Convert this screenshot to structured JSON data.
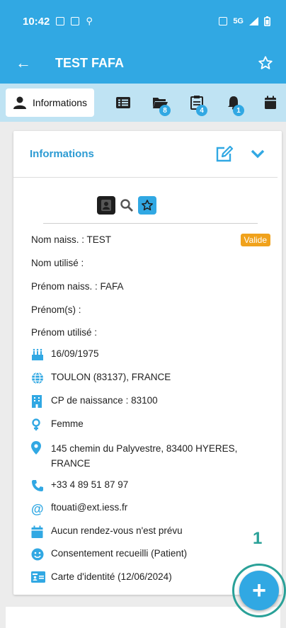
{
  "status_bar": {
    "time": "10:42",
    "network": "5G"
  },
  "app_bar": {
    "title": "TEST FAFA"
  },
  "tabs": {
    "active_label": "Informations",
    "badges": {
      "folder": "8",
      "document": "4",
      "alerts": "1"
    }
  },
  "card": {
    "title": "Informations",
    "status_badge": "Valide",
    "fields": {
      "nom_naiss": "Nom naiss. :  TEST",
      "nom_utilise": "Nom utilisé :",
      "prenom_naiss": "Prénom naiss. :  FAFA",
      "prenoms": "Prénom(s) :",
      "prenom_utilise": "Prénom utilisé :"
    },
    "details": {
      "birth_date": "16/09/1975",
      "birth_place": "TOULON (83137), FRANCE",
      "birth_postal": "CP de naissance : 83100",
      "gender": "Femme",
      "address_line1": "145 chemin du Palyvestre, 83400 HYERES,",
      "address_line2": "FRANCE",
      "phone": "+33 4 89 51 87 97",
      "email": "ftouati@ext.iess.fr",
      "appointments": "Aucun rendez-vous n'est prévu",
      "consent": "Consentement recueilli (Patient)",
      "id_card": "Carte d'identité (12/06/2024)"
    }
  },
  "fab": {
    "annotation": "1",
    "symbol": "+"
  },
  "colors": {
    "primary": "#31a8e3",
    "tab_bg": "#bfe3f3",
    "badge_valide": "#f0a21c",
    "teal_highlight": "#2aa198"
  }
}
